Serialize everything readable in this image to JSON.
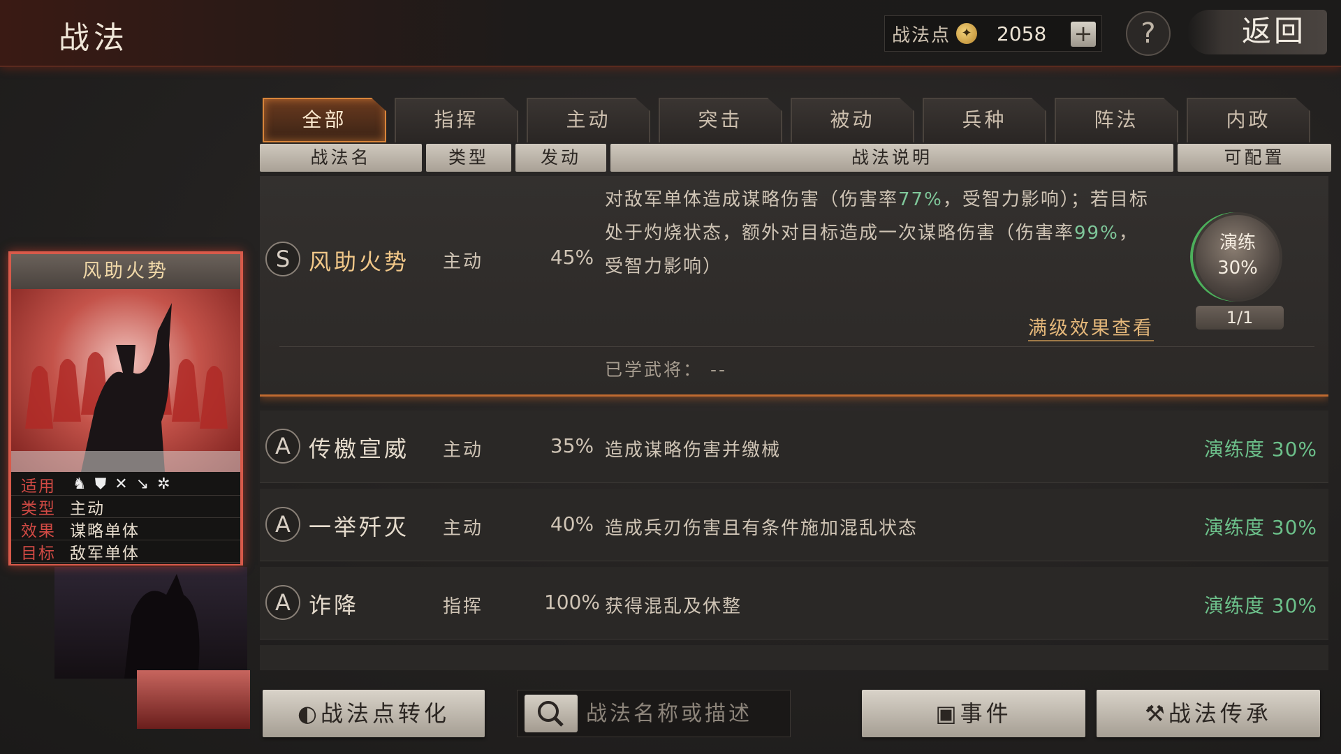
{
  "header": {
    "title": "战法",
    "points_label": "战法点",
    "points_value": "2058",
    "plus_label": "+",
    "help_label": "?",
    "back_label": "返回"
  },
  "tabs": [
    {
      "label": "全部",
      "active": true
    },
    {
      "label": "指挥"
    },
    {
      "label": "主动"
    },
    {
      "label": "突击"
    },
    {
      "label": "被动"
    },
    {
      "label": "兵种"
    },
    {
      "label": "阵法"
    },
    {
      "label": "内政"
    }
  ],
  "columns": [
    "战法名",
    "类型",
    "发动",
    "战法说明",
    "可配置"
  ],
  "expanded": {
    "grade": "S",
    "name": "风助火势",
    "type": "主动",
    "rate": "45%",
    "desc_1": "对敌军单体造成谋略伤害（伤害率",
    "desc_hl1": "77%",
    "desc_2": "，受智力影响）；若目标处于灼烧状态，额外对目标造成一次谋略伤害（伤害率",
    "desc_hl2": "99%",
    "desc_3": "，受智力影响）",
    "full_effect_link": "满级效果查看",
    "dial_label": "演练",
    "dial_value": "30%",
    "dial_count": "1/1",
    "learned": "已学武将：  --"
  },
  "rows": [
    {
      "grade": "A",
      "name": "传檄宣威",
      "type": "主动",
      "rate": "35%",
      "desc": "造成谋略伤害并缴械",
      "drill": "演练度 30%"
    },
    {
      "grade": "A",
      "name": "一举歼灭",
      "type": "主动",
      "rate": "40%",
      "desc": "造成兵刃伤害且有条件施加混乱状态",
      "drill": "演练度 30%"
    },
    {
      "grade": "A",
      "name": "诈降",
      "type": "指挥",
      "rate": "100%",
      "desc": "获得混乱及休整",
      "drill": "演练度 30%"
    }
  ],
  "card": {
    "title": "风助火势",
    "stats": [
      {
        "key": "适用",
        "value": ""
      },
      {
        "key": "类型",
        "value": "主动"
      },
      {
        "key": "效果",
        "value": "谋略单体"
      },
      {
        "key": "目标",
        "value": "敌军单体"
      }
    ]
  },
  "footer": {
    "convert_label": "战法点转化",
    "search_placeholder": "战法名称或描述",
    "event_label": "事件",
    "inherit_label": "战法传承"
  },
  "colors": {
    "accent": "#d9853a",
    "highlight": "#7fc79a",
    "card_border": "#d85a4a"
  }
}
